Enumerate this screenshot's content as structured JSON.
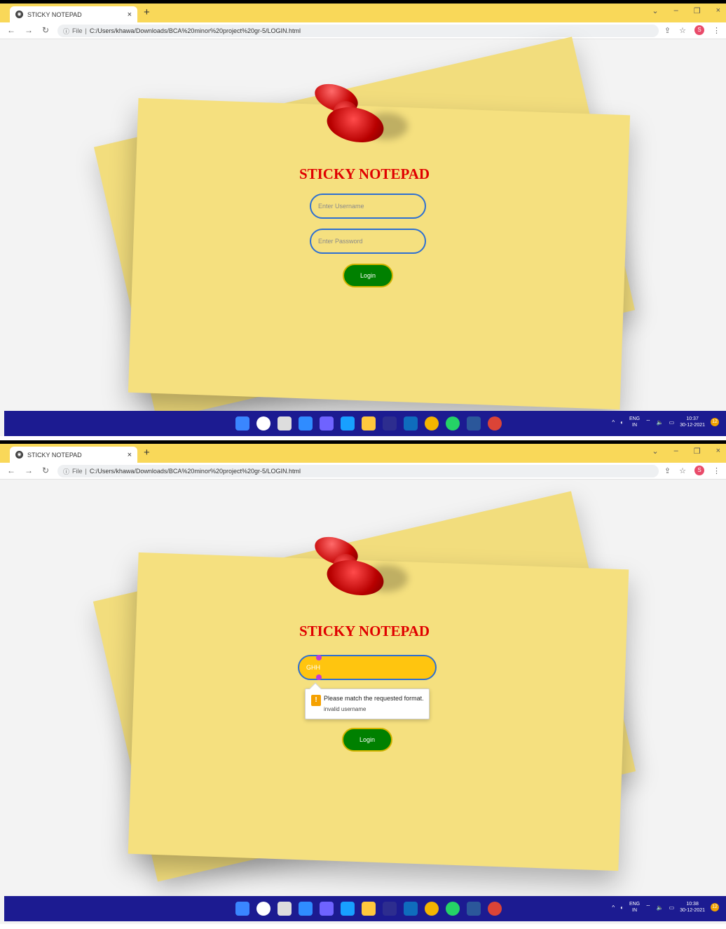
{
  "screens": [
    {
      "tab_title": "STICKY NOTEPAD",
      "url_label": "File",
      "url": "C:/Users/khawa/Downloads/BCA%20minor%20project%20gr-5/LOGIN.html",
      "profile_initial": "S",
      "app_title": "STICKY NOTEPAD",
      "username_placeholder": "Enter Username",
      "password_placeholder": "Enter Password",
      "login_label": "Login",
      "lang": "ENG",
      "region": "IN",
      "time": "10:37",
      "date": "30-12-2021",
      "notification_count": "12"
    },
    {
      "tab_title": "STICKY NOTEPAD",
      "url_label": "File",
      "url": "C:/Users/khawa/Downloads/BCA%20minor%20project%20gr-5/LOGIN.html",
      "profile_initial": "S",
      "app_title": "STICKY NOTEPAD",
      "username_value": "GHH",
      "tooltip_title": "Please match the requested format.",
      "tooltip_message": "invalid username",
      "login_label": "Login",
      "lang": "ENG",
      "region": "IN",
      "time": "10:38",
      "date": "30-12-2021",
      "notification_count": "12"
    }
  ],
  "colors": {
    "tab_bar": "#f9d859",
    "paper": "#f5e07f",
    "title": "#e00000",
    "field_border": "#2d6fd2",
    "login_button": "#008000",
    "active_field": "#ffc50f",
    "taskbar": "#1c1b91"
  },
  "taskbar_icons": [
    "windows-start",
    "search",
    "task-view",
    "widgets",
    "chat",
    "edge",
    "file-explorer",
    "store",
    "mail",
    "chrome",
    "whatsapp",
    "word",
    "chrome-active"
  ]
}
